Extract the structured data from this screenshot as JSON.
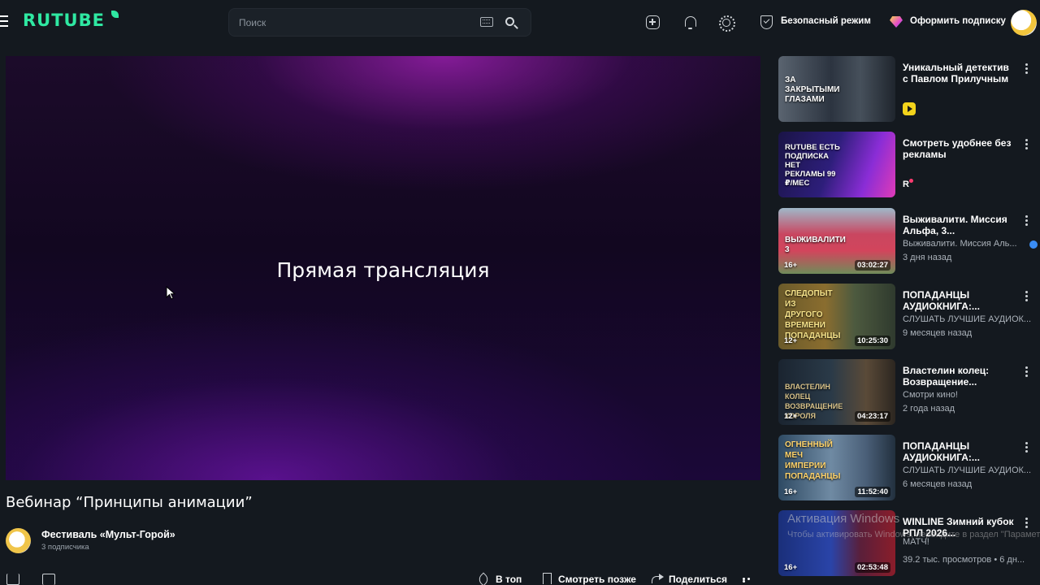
{
  "header": {
    "logo_text": "RUTUBE",
    "search_placeholder": "Поиск",
    "safe_mode_label": "Безопасный режим",
    "subscribe_label": "Оформить подписку"
  },
  "player": {
    "overlay_text": "Прямая трансляция"
  },
  "video": {
    "title": "Вебинар “Принципы анимации”",
    "channel_name": "Фестиваль «Мульт-Горой»",
    "subscribers": "3 подписчика"
  },
  "actions": {
    "top_label": "В топ",
    "watch_later_label": "Смотреть позже",
    "share_label": "Поделиться"
  },
  "recommendations": [
    {
      "title": "Уникальный детектив с Павлом Прилучным",
      "thumb_caption": "За закрытыми глазами",
      "channel": "",
      "meta": "",
      "age": "",
      "duration": "",
      "badge": "yellow-play-badge"
    },
    {
      "title": "Смотреть удобнее без рекламы",
      "thumb_caption": "RUTUBE Есть подписка нет рекламы 99 ₽/мес",
      "channel": "",
      "meta": "",
      "age": "",
      "duration": "",
      "badge": "r-badge"
    },
    {
      "title": "Выживалити. Миссия Альфа, 3...",
      "thumb_caption": "Выживалити 3",
      "channel": "Выживалити. Миссия Аль...",
      "meta": "3 дня назад",
      "age": "16+",
      "duration": "03:02:27",
      "badge": "verified"
    },
    {
      "title": "ПОПАДАНЦЫ АУДИОКНИГА:...",
      "thumb_caption": "Следопыт из другого времени попаданцы",
      "channel": "СЛУШАТЬ ЛУЧШИЕ АУДИОК...",
      "meta": "9 месяцев назад",
      "age": "12+",
      "duration": "10:25:30",
      "badge": ""
    },
    {
      "title": "Властелин колец: Возвращение...",
      "thumb_caption": "Властелин колец Возвращение короля",
      "channel": "Смотри кино!",
      "meta": "2 года назад",
      "age": "12+",
      "duration": "04:23:17",
      "badge": ""
    },
    {
      "title": "ПОПАДАНЦЫ АУДИОКНИГА:...",
      "thumb_caption": "Огненный меч империи попаданцы",
      "channel": "СЛУШАТЬ ЛУЧШИЕ АУДИОК...",
      "meta": "6 месяцев назад",
      "age": "16+",
      "duration": "11:52:40",
      "badge": ""
    },
    {
      "title": "WINLINE Зимний кубок РПЛ 2026...",
      "thumb_caption": "",
      "channel": "МАТЧ!",
      "meta": "39.2 тыс. просмотров • 6 дн...",
      "age": "16+",
      "duration": "02:53:48",
      "badge": "verified"
    }
  ],
  "watermark": {
    "line1": "Активация Windows",
    "line2": "Чтобы активировать Windows, перейдите в раздел \"Параметры\"."
  }
}
